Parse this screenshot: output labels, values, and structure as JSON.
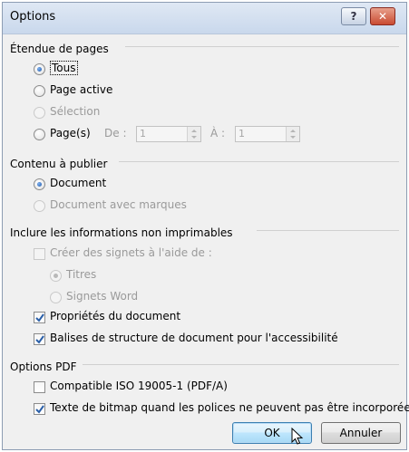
{
  "window": {
    "title": "Options",
    "help_glyph": "?",
    "close_glyph": "✕"
  },
  "page_range": {
    "header": "Étendue de pages",
    "options": [
      {
        "label": "Tous",
        "selected": true,
        "enabled": true
      },
      {
        "label": "Page active",
        "selected": false,
        "enabled": true
      },
      {
        "label": "Sélection",
        "selected": false,
        "enabled": false
      },
      {
        "label": "Page(s)",
        "selected": false,
        "enabled": true
      }
    ],
    "from_label": "De :",
    "from_value": "1",
    "to_label": "À :",
    "to_value": "1"
  },
  "publish": {
    "header": "Contenu à publier",
    "options": [
      {
        "label": "Document",
        "selected": true,
        "enabled": true
      },
      {
        "label": "Document avec marques",
        "selected": false,
        "enabled": false
      }
    ]
  },
  "nonprint": {
    "header": "Inclure les informations non imprimables",
    "bookmarks_label": "Créer des signets à l'aide de :",
    "bookmarks_checked": false,
    "bookmarks_enabled": false,
    "bookmark_options": [
      {
        "label": "Titres",
        "selected": true,
        "enabled": false
      },
      {
        "label": "Signets Word",
        "selected": false,
        "enabled": false
      }
    ],
    "properties_label": "Propriétés du document",
    "properties_checked": true,
    "tags_label": "Balises de structure de document pour l'accessibilité",
    "tags_checked": true
  },
  "pdf": {
    "header": "Options PDF",
    "iso_label": "Compatible ISO 19005-1 (PDF/A)",
    "iso_checked": false,
    "bitmap_label": "Texte de bitmap quand les polices ne peuvent pas être incorporées",
    "bitmap_checked": true
  },
  "buttons": {
    "ok": "OK",
    "cancel": "Annuler"
  },
  "colors": {
    "accent": "#1e57a8",
    "dialog_bg": "#f0f0f0",
    "close_red": "#c94b32"
  }
}
